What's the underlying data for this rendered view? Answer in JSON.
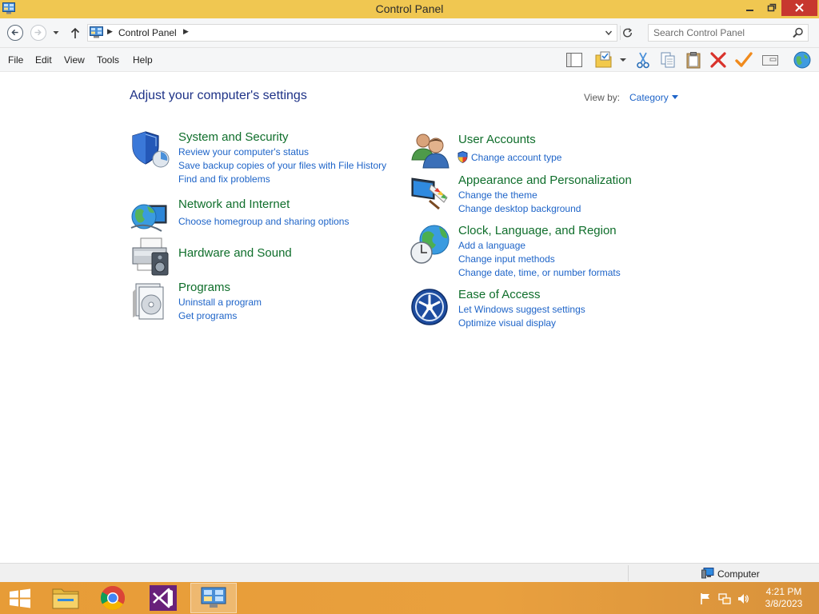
{
  "window": {
    "title": "Control Panel",
    "accent": "#f0c751",
    "close_color": "#c7372f"
  },
  "address": {
    "breadcrumb": "Control Panel",
    "search_placeholder": "Search Control Panel"
  },
  "menu": {
    "items": [
      "File",
      "Edit",
      "View",
      "Tools",
      "Help"
    ]
  },
  "toolbar": {
    "icons": [
      "layout-icon",
      "folder-options-icon",
      "dropdown-icon",
      "cut-icon",
      "copy-icon",
      "paste-icon",
      "delete-icon",
      "checkmark-icon",
      "properties-icon",
      "globe-icon"
    ]
  },
  "main": {
    "page_title": "Adjust your computer's settings",
    "view_by_label": "View by:",
    "view_by_value": "Category",
    "link_color": "#1e64c8",
    "title_color": "#0f6e2b",
    "categories": [
      {
        "title": "System and Security",
        "icon": "shield-icon",
        "links": [
          "Review your computer's status",
          "Save backup copies of your files with File History",
          "Find and fix problems"
        ]
      },
      {
        "title": "Network and Internet",
        "icon": "network-globe-icon",
        "links": [
          "Choose homegroup and sharing options"
        ]
      },
      {
        "title": "Hardware and Sound",
        "icon": "printer-icon",
        "links": []
      },
      {
        "title": "Programs",
        "icon": "programs-icon",
        "links": [
          "Uninstall a program",
          "Get programs"
        ]
      },
      {
        "title": "User Accounts",
        "icon": "users-icon",
        "links": [
          "Change account type"
        ]
      },
      {
        "title": "Appearance and Personalization",
        "icon": "monitor-paint-icon",
        "links": [
          "Change the theme",
          "Change desktop background"
        ]
      },
      {
        "title": "Clock, Language, and Region",
        "icon": "clock-globe-icon",
        "links": [
          "Add a language",
          "Change input methods",
          "Change date, time, or number formats"
        ]
      },
      {
        "title": "Ease of Access",
        "icon": "ease-of-access-icon",
        "links": [
          "Let Windows suggest settings",
          "Optimize visual display"
        ]
      }
    ]
  },
  "statusbar": {
    "location": "Computer"
  },
  "taskbar": {
    "apps": [
      "start-button",
      "file-explorer-icon",
      "chrome-icon",
      "visual-studio-icon",
      "control-panel-icon"
    ],
    "time": "4:21 PM",
    "date": "3/8/2023"
  }
}
